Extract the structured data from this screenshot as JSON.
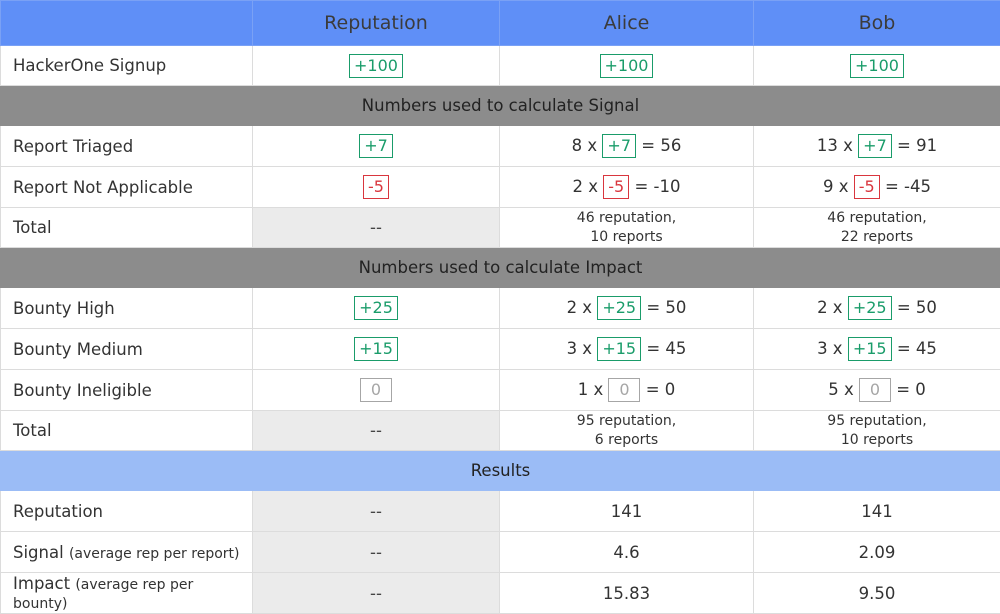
{
  "header": {
    "col1": "Reputation",
    "col2": "Alice",
    "col3": "Bob"
  },
  "signup": {
    "label": "HackerOne Signup",
    "rep": "+100",
    "alice": "+100",
    "bob": "+100"
  },
  "section_signal": "Numbers used to calculate Signal",
  "triaged": {
    "label": "Report Triaged",
    "rep": "+7",
    "alice": {
      "mult": "8 x",
      "pts": "+7",
      "res": "= 56"
    },
    "bob": {
      "mult": "13 x",
      "pts": "+7",
      "res": "= 91"
    }
  },
  "not_applicable": {
    "label": "Report Not Applicable",
    "rep": "-5",
    "alice": {
      "mult": "2 x",
      "pts": "-5",
      "res": "= -10"
    },
    "bob": {
      "mult": "9 x",
      "pts": "-5",
      "res": "= -45"
    }
  },
  "signal_total": {
    "label": "Total",
    "rep": "--",
    "alice_line1": "46 reputation,",
    "alice_line2": "10 reports",
    "bob_line1": "46 reputation,",
    "bob_line2": "22 reports"
  },
  "section_impact": "Numbers used to calculate Impact",
  "bounty_high": {
    "label": "Bounty High",
    "rep": "+25",
    "alice": {
      "mult": "2 x",
      "pts": "+25",
      "res": "= 50"
    },
    "bob": {
      "mult": "2 x",
      "pts": "+25",
      "res": "= 50"
    }
  },
  "bounty_medium": {
    "label": "Bounty Medium",
    "rep": "+15",
    "alice": {
      "mult": "3 x",
      "pts": "+15",
      "res": "= 45"
    },
    "bob": {
      "mult": "3 x",
      "pts": "+15",
      "res": "= 45"
    }
  },
  "bounty_ineligible": {
    "label": "Bounty Ineligible",
    "rep": "0",
    "alice": {
      "mult": "1 x",
      "pts": "0",
      "res": "= 0"
    },
    "bob": {
      "mult": "5 x",
      "pts": "0",
      "res": "= 0"
    }
  },
  "impact_total": {
    "label": "Total",
    "rep": "--",
    "alice_line1": "95 reputation,",
    "alice_line2": "6 reports",
    "bob_line1": "95 reputation,",
    "bob_line2": "10 reports"
  },
  "section_results": "Results",
  "res_reputation": {
    "label": "Reputation",
    "rep": "--",
    "alice": "141",
    "bob": "141"
  },
  "res_signal": {
    "label": "Signal",
    "note": "(average rep per report)",
    "rep": "--",
    "alice": "4.6",
    "bob": "2.09"
  },
  "res_impact": {
    "label": "Impact",
    "note": "(average rep per bounty)",
    "rep": "--",
    "alice": "15.83",
    "bob": "9.50"
  },
  "colors": {
    "header_bg": "#5f8ff7",
    "section_bg": "#8c8c8c",
    "results_bg": "#9bbcf6",
    "positive": "#1a9c6a",
    "negative": "#d9363e",
    "neutral": "#a6a6a6",
    "na_cell": "#ebebeb"
  }
}
